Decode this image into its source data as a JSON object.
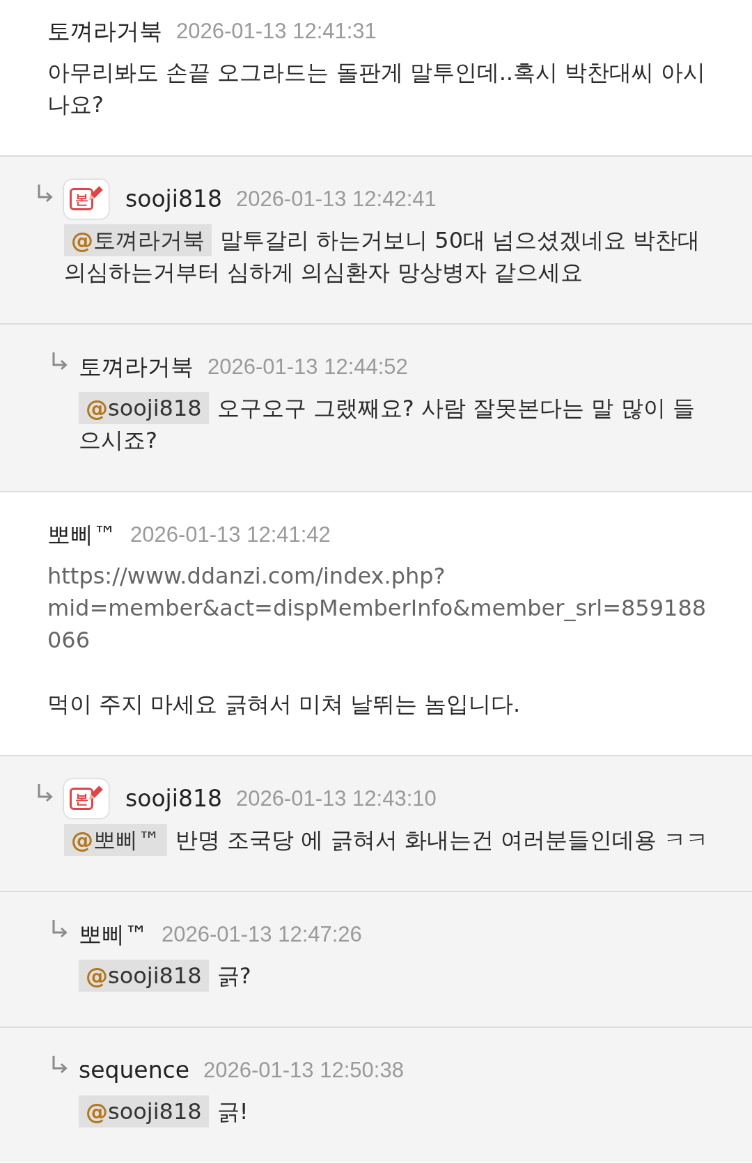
{
  "comments": [
    {
      "author": "토껴라거북",
      "time": "2026-01-13 12:41:31",
      "paragraphs": [
        {
          "kind": "text",
          "text": "아무리봐도 손끝 오그라드는 돌판게 말투인데..혹시 박찬대씨 아시나요?"
        }
      ],
      "children": [
        {
          "author": "sooji818",
          "badge": "본",
          "time": "2026-01-13 12:42:41",
          "mention": {
            "symbol": "@",
            "user": "토껴라거북"
          },
          "paragraphs": [
            {
              "kind": "text",
              "text": "말투갈리 하는거보니 50대 넘으셨겠네요 박찬대 의심하는거부터 심하게 의심환자 망상병자 같으세요"
            }
          ],
          "children": [
            {
              "author": "토껴라거북",
              "time": "2026-01-13 12:44:52",
              "mention": {
                "symbol": "@",
                "user": "sooji818"
              },
              "paragraphs": [
                {
                  "kind": "text",
                  "text": "오구오구 그랬째요? 사람 잘못본다는 말 많이 들으시죠?"
                }
              ]
            }
          ]
        }
      ]
    },
    {
      "author": "뽀삐™",
      "time": "2026-01-13 12:41:42",
      "paragraphs": [
        {
          "kind": "link",
          "text": "https://www.ddanzi.com/index.php?mid=member&act=dispMemberInfo&member_srl=859188066"
        },
        {
          "kind": "text",
          "text": "먹이 주지 마세요 긁혀서 미쳐 날뛰는 놈입니다."
        }
      ],
      "children": [
        {
          "author": "sooji818",
          "badge": "본",
          "time": "2026-01-13 12:43:10",
          "mention": {
            "symbol": "@",
            "user": "뽀삐™"
          },
          "paragraphs": [
            {
              "kind": "text",
              "text": "반명 조국당 에 긁혀서 화내는건 여러분들인데용 ㅋㅋ"
            }
          ],
          "children": [
            {
              "author": "뽀삐™",
              "time": "2026-01-13 12:47:26",
              "mention": {
                "symbol": "@",
                "user": "sooji818"
              },
              "paragraphs": [
                {
                  "kind": "text",
                  "text": "긁?"
                }
              ]
            },
            {
              "author": "sequence",
              "time": "2026-01-13 12:50:38",
              "mention": {
                "symbol": "@",
                "user": "sooji818"
              },
              "paragraphs": [
                {
                  "kind": "text",
                  "text": "긁!"
                }
              ]
            }
          ]
        }
      ]
    }
  ]
}
